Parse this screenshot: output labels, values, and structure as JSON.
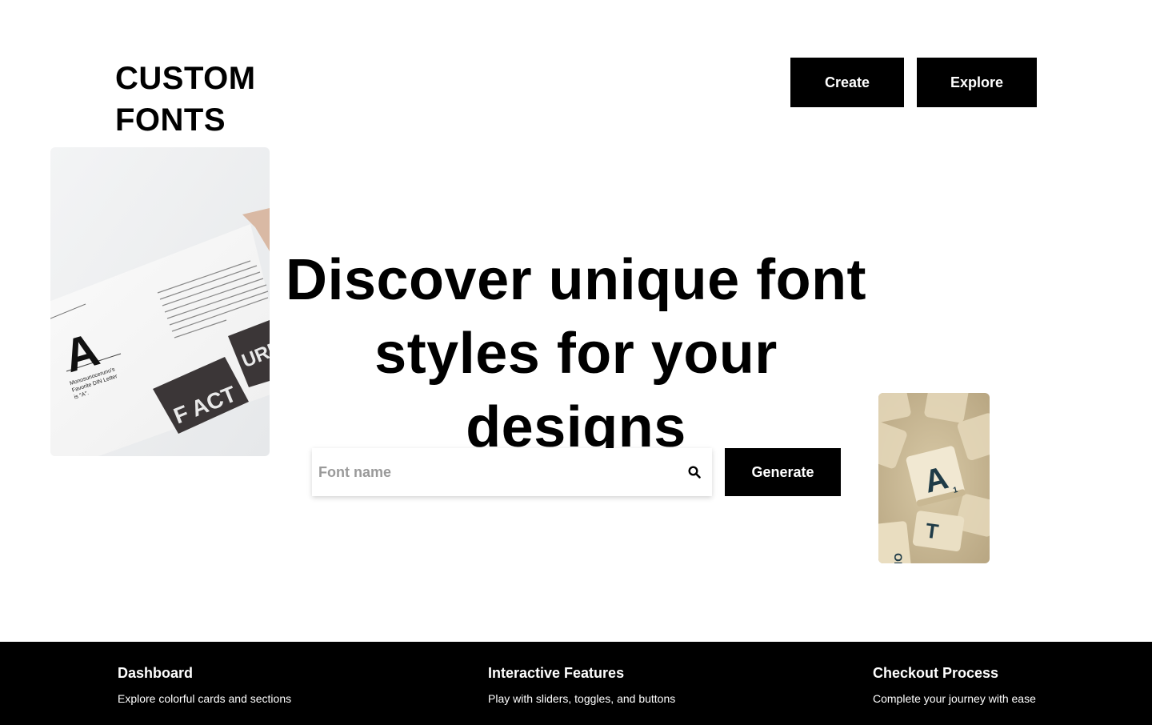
{
  "header": {
    "logo_line1": "CUSTOM",
    "logo_line2": "FONTS",
    "nav": {
      "create_label": "Create",
      "explore_label": "Explore"
    }
  },
  "hero": {
    "title_line1": "Discover unique font",
    "title_line2": "styles for your designs",
    "search": {
      "placeholder": "Font name",
      "icon": "search-icon"
    },
    "generate_label": "Generate"
  },
  "images": {
    "magazine": {
      "big_letter": "A",
      "caption_line1": "Monosunoceruno's",
      "caption_line2": "Favorite DIN Letter",
      "caption_line3": "is \"A\".",
      "card_text": "F ACT",
      "card_text2": "URE"
    },
    "tiles": {
      "tile_letter": "A",
      "tile_letter2": "T",
      "edge_text": "ORE"
    }
  },
  "footer": {
    "columns": [
      {
        "title": "Dashboard",
        "text": "Explore colorful cards and sections"
      },
      {
        "title": "Interactive Features",
        "text": "Play with sliders, toggles, and buttons"
      },
      {
        "title": "Checkout Process",
        "text": "Complete your journey with ease"
      }
    ]
  },
  "colors": {
    "primary": "#000000",
    "background": "#ffffff",
    "placeholder": "#9a9a9a"
  }
}
